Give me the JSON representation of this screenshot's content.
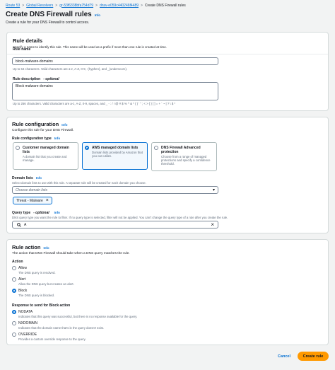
{
  "breadcrumb": {
    "items": [
      "Route 53",
      "Global Resolvers",
      "gr-53f6338bfa754d79",
      "dnsv-e059c440246f4489"
    ],
    "current": "Create DNS Firewall rules",
    "separator": ">"
  },
  "header": {
    "title": "Create DNS Firewall rules",
    "info": "Info",
    "subtitle": "Create a rule for your DNS Firewall to control access."
  },
  "rule_details": {
    "title": "Rule details",
    "description": "Specify a name to identify this rule. This name will be used as a prefix if more than one rule is created at time.",
    "name_label": "Rule name",
    "name_value": "block-malware-domains",
    "name_hint": "Up to 64 characters. Valid characters are a-z, A-Z, 0-9, -(hyphen), and _(underscore).",
    "desc_label": "Rule description",
    "desc_optional": "- optional",
    "desc_value": "Block malware domains",
    "desc_hint": "Up to 256 characters. Valid characters are a-z, A-Z, 0-9, spaces, and _ - : / ! @ # $ % ^ & * ( ) ' \" ; < > { } [ ] = + ` ~ | ? \\ $ *"
  },
  "rule_config": {
    "title": "Rule configuration",
    "info": "Info",
    "description": "Configure this rule for your DNS Firewall.",
    "type_label": "Rule configuration type",
    "type_info": "Info",
    "tiles": [
      {
        "title": "Customer managed domain lists",
        "desc": "A domain list that you create and manage."
      },
      {
        "title": "AWS managed domain lists",
        "desc": "Domain lists provided by Amazon that you can utilize."
      },
      {
        "title": "DNS Firewall Advanced protection",
        "desc": "Choose from a range of managed protections and specify a confidence threshold."
      }
    ],
    "domain_label": "Domain lists",
    "domain_info": "Info",
    "domain_desc": "Select domain lists to use with this rule. A separate rule will be created for each domain you choose.",
    "domain_placeholder": "Choose domain lists",
    "token": "Threat - Malware",
    "query_label": "Query type",
    "query_optional": "- optional",
    "query_info": "Info",
    "query_desc": "DNS query type you want the rule to filter. If no query type is selected, filter will not be applied. You can't change the query type of a rule after you create the rule.",
    "query_value": "A"
  },
  "rule_action": {
    "title": "Rule action",
    "info": "Info",
    "description": "The action that DNS Firewall should take when a DNS query matches the rule.",
    "action_label": "Action",
    "actions": [
      {
        "label": "Allow",
        "desc": "The DNS query is resolved."
      },
      {
        "label": "Alert",
        "desc": "Allow the DNS query but creates an alert."
      },
      {
        "label": "Block",
        "desc": "The DNS query is blocked."
      }
    ],
    "response_label": "Response to send for Block action",
    "responses": [
      {
        "label": "NODATA",
        "desc": "Indicates that this query was successful, but there is no response available for the query."
      },
      {
        "label": "NXDOMAIN",
        "desc": "Indicates that the domain name that's in the query doesn't exist."
      },
      {
        "label": "OVERRIDE",
        "desc": "Provides a custom override response to the query."
      }
    ]
  },
  "footer": {
    "cancel": "Cancel",
    "create": "Create rule"
  }
}
